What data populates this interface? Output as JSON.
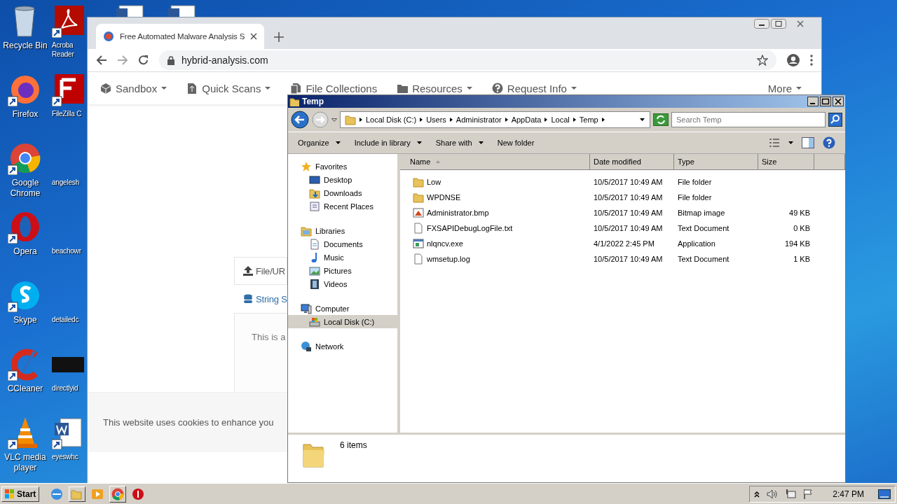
{
  "desktop_icons": [
    {
      "label": "Recycle Bin",
      "kind": "recycle"
    },
    {
      "label": "Firefox",
      "kind": "firefox"
    },
    {
      "label": "Google Chrome",
      "kind": "chrome"
    },
    {
      "label": "Opera",
      "kind": "opera"
    },
    {
      "label": "Skype",
      "kind": "skype"
    },
    {
      "label": "CCleaner",
      "kind": "ccleaner"
    },
    {
      "label": "VLC media player",
      "kind": "vlc"
    }
  ],
  "desktop_icons_second_column": [
    {
      "label": "Acroba Reader",
      "kind": "acrobat"
    },
    {
      "label": "FileZilla C",
      "kind": "filezilla"
    },
    {
      "label": "angelesh",
      "kind": "blank"
    },
    {
      "label": "beachowr",
      "kind": "blank"
    },
    {
      "label": "detailedc",
      "kind": "blank"
    },
    {
      "label": "directlyid",
      "kind": "dark"
    },
    {
      "label": "eyeswhc",
      "kind": "word"
    }
  ],
  "browser": {
    "tab_title": "Free Automated Malware Analysis S",
    "address": "hybrid-analysis.com",
    "nav": [
      {
        "label": "Sandbox",
        "kind": "cube",
        "has_menu": true
      },
      {
        "label": "Quick Scans",
        "kind": "file",
        "has_menu": true
      },
      {
        "label": "File Collections",
        "kind": "files",
        "has_menu": false
      },
      {
        "label": "Resources",
        "kind": "folder",
        "has_menu": true
      },
      {
        "label": "Request Info",
        "kind": "question",
        "has_menu": true
      },
      {
        "label": "More",
        "kind": "none",
        "has_menu": true
      }
    ],
    "panel_tabs": [
      {
        "label": "File/UR",
        "kind": "upload",
        "selected": true
      },
      {
        "label": "String S",
        "kind": "database",
        "selected": false
      }
    ],
    "panel_text": "This is a",
    "cookie_notice": "This website uses cookies to enhance you"
  },
  "explorer": {
    "title": "Temp",
    "breadcrumb": [
      "Local Disk (C:)",
      "Users",
      "Administrator",
      "AppData",
      "Local",
      "Temp"
    ],
    "search": {
      "placeholder": "Search Temp"
    },
    "toolbar": [
      {
        "label": "Organize",
        "has_menu": true
      },
      {
        "label": "Include in library",
        "has_menu": true
      },
      {
        "label": "Share with",
        "has_menu": true
      },
      {
        "label": "New folder",
        "has_menu": false
      }
    ],
    "nav_pane": [
      {
        "label": "Favorites",
        "kind": "star",
        "selected": false,
        "children": [
          {
            "label": "Desktop",
            "kind": "desktop",
            "selected": false
          },
          {
            "label": "Downloads",
            "kind": "downloads",
            "selected": false
          },
          {
            "label": "Recent Places",
            "kind": "recent",
            "selected": false
          }
        ]
      },
      {
        "label": "Libraries",
        "kind": "library",
        "selected": false,
        "children": [
          {
            "label": "Documents",
            "kind": "document",
            "selected": false
          },
          {
            "label": "Music",
            "kind": "music",
            "selected": false
          },
          {
            "label": "Pictures",
            "kind": "pictures",
            "selected": false
          },
          {
            "label": "Videos",
            "kind": "videos",
            "selected": false
          }
        ]
      },
      {
        "label": "Computer",
        "kind": "computer",
        "selected": false,
        "children": [
          {
            "label": "Local Disk (C:)",
            "kind": "disk",
            "selected": true
          }
        ]
      },
      {
        "label": "Network",
        "kind": "network",
        "selected": false
      }
    ],
    "columns": [
      "Name",
      "Date modified",
      "Type",
      "Size"
    ],
    "rows": [
      {
        "name": "Low",
        "date": "10/5/2017 10:49 AM",
        "type": "File folder",
        "kind": "folder"
      },
      {
        "name": "WPDNSE",
        "date": "10/5/2017 10:49 AM",
        "type": "File folder",
        "kind": "folder"
      },
      {
        "name": "Administrator.bmp",
        "date": "10/5/2017 10:49 AM",
        "type": "Bitmap image",
        "size": "49 KB",
        "kind": "bitmap"
      },
      {
        "name": "FXSAPIDebugLogFile.txt",
        "date": "10/5/2017 10:49 AM",
        "type": "Text Document",
        "size": "0 KB",
        "kind": "text"
      },
      {
        "name": "nlqncv.exe",
        "date": "4/1/2022 2:45 PM",
        "type": "Application",
        "size": "194 KB",
        "kind": "exe"
      },
      {
        "name": "wmsetup.log",
        "date": "10/5/2017 10:49 AM",
        "type": "Text Document",
        "size": "1 KB",
        "kind": "text"
      }
    ],
    "status": "6 items"
  },
  "taskbar": {
    "start": "Start",
    "clock": "2:47 PM"
  }
}
